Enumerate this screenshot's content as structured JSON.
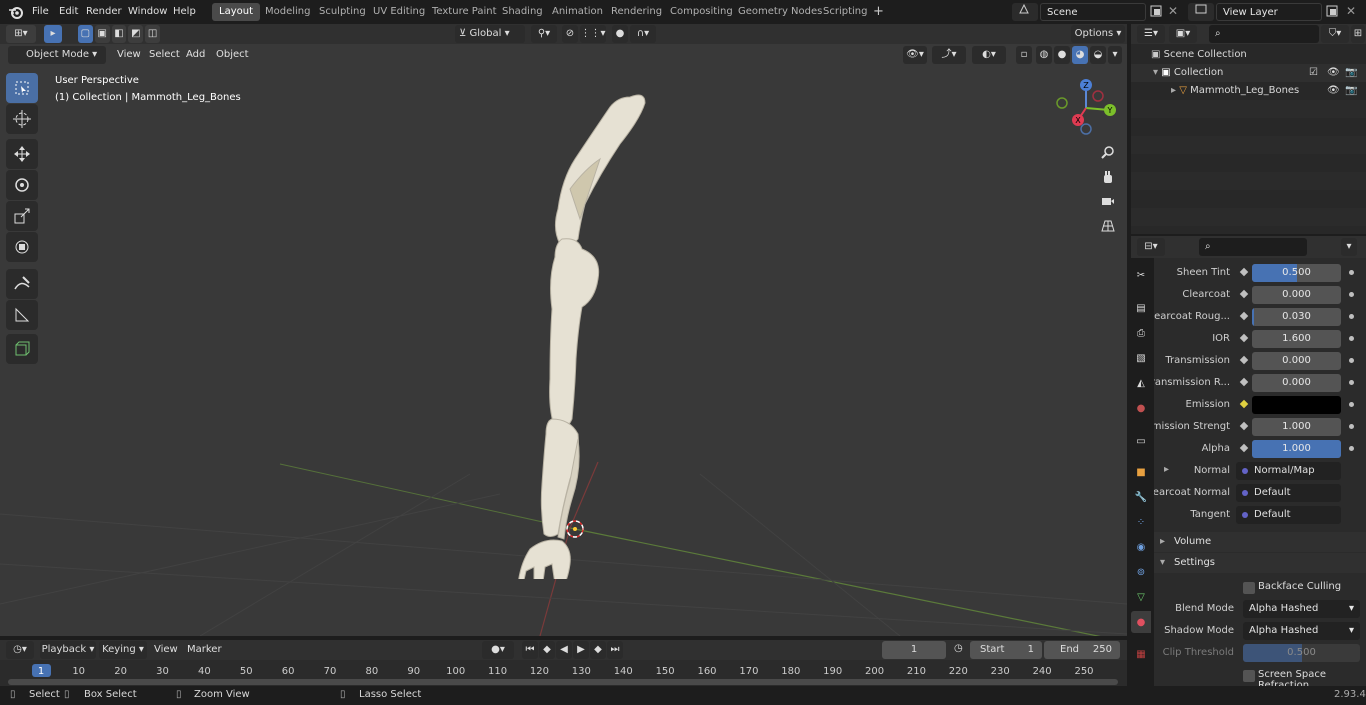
{
  "topbar": {
    "menus": [
      "File",
      "Edit",
      "Render",
      "Window",
      "Help"
    ],
    "workspaces": [
      "Layout",
      "Modeling",
      "Sculpting",
      "UV Editing",
      "Texture Paint",
      "Shading",
      "Animation",
      "Rendering",
      "Compositing",
      "Geometry Nodes",
      "Scripting"
    ],
    "active_workspace": "Layout",
    "add_tab": "+",
    "scene": "Scene",
    "view_layer": "View Layer"
  },
  "viewport_header": {
    "mode": "Object Mode",
    "menus": [
      "View",
      "Select",
      "Add",
      "Object"
    ],
    "orientation": "Global",
    "options": "Options"
  },
  "viewport": {
    "perspective": "User Perspective",
    "collection_info": "(1) Collection | Mammoth_Leg_Bones",
    "gizmo_axes": {
      "z": "Z",
      "y": "Y",
      "x": "X"
    },
    "bg_color": "#393939",
    "grid_x_color": "#7a3a3a",
    "grid_y_color": "#5b7a3a",
    "bone_color": "#e8e3d6"
  },
  "outliner": {
    "search_placeholder": "",
    "scene_collection": "Scene Collection",
    "collection": "Collection",
    "object": "Mammoth_Leg_Bones"
  },
  "properties": {
    "rows": [
      {
        "label": "Sheen Tint",
        "type": "slider",
        "value": "0.500",
        "fraction": 0.5
      },
      {
        "label": "Clearcoat",
        "type": "number",
        "value": "0.000"
      },
      {
        "label": "Clearcoat Roug...",
        "type": "slider",
        "value": "0.030",
        "fraction": 0.03
      },
      {
        "label": "IOR",
        "type": "number",
        "value": "1.600"
      },
      {
        "label": "Transmission",
        "type": "number",
        "value": "0.000"
      },
      {
        "label": "Transmission R...",
        "type": "number",
        "value": "0.000"
      },
      {
        "label": "Emission",
        "type": "color",
        "color": "#000000"
      },
      {
        "label": "Emission Strengt",
        "type": "number",
        "value": "1.000"
      },
      {
        "label": "Alpha",
        "type": "slider",
        "value": "1.000",
        "fraction": 1.0
      },
      {
        "label": "Normal",
        "type": "link",
        "value": "Normal/Map"
      },
      {
        "label": "Clearcoat Normal",
        "type": "link",
        "value": "Default"
      },
      {
        "label": "Tangent",
        "type": "link",
        "value": "Default"
      }
    ],
    "volume_section": "Volume",
    "settings_section": "Settings",
    "backface_culling": "Backface Culling",
    "blend_mode_label": "Blend Mode",
    "blend_mode": "Alpha Hashed",
    "shadow_mode_label": "Shadow Mode",
    "shadow_mode": "Alpha Hashed",
    "clip_threshold_label": "Clip Threshold",
    "clip_threshold": "0.500",
    "screen_space_refraction": "Screen Space Refraction"
  },
  "timeline": {
    "menus": [
      "Playback",
      "Keying",
      "View",
      "Marker"
    ],
    "current_frame": "1",
    "start_label": "Start",
    "start": "1",
    "end_label": "End",
    "end": "250",
    "ruler": [
      "1",
      "10",
      "20",
      "30",
      "40",
      "50",
      "60",
      "70",
      "80",
      "90",
      "100",
      "110",
      "120",
      "130",
      "140",
      "150",
      "160",
      "170",
      "180",
      "190",
      "200",
      "210",
      "220",
      "230",
      "240",
      "250"
    ]
  },
  "statusbar": {
    "select": "Select",
    "box_select": "Box Select",
    "zoom_view": "Zoom View",
    "lasso_select": "Lasso Select",
    "version": "2.93.4"
  }
}
